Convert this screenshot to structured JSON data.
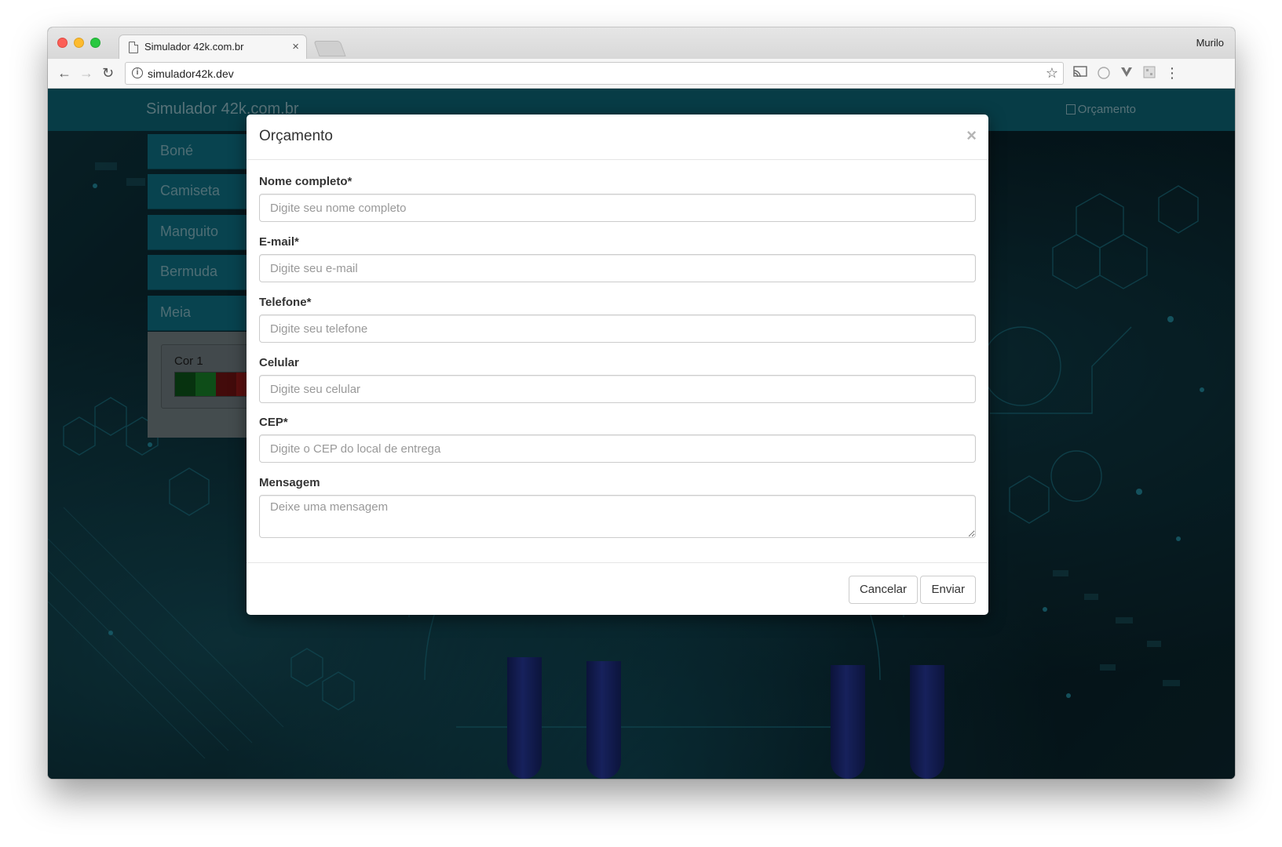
{
  "browser": {
    "tab_title": "Simulador 42k.com.br",
    "tab_close": "×",
    "profile_name": "Murilo",
    "url": "simulador42k.dev",
    "back_icon": "←",
    "forward_icon": "→",
    "reload_icon": "↻",
    "star_icon": "☆",
    "menu_icon": "⋮"
  },
  "site": {
    "brand": "Simulador 42k.com.br",
    "nav_link": "Orçamento",
    "menu": [
      "Boné",
      "Camiseta",
      "Manguito",
      "Bermuda",
      "Meia"
    ],
    "panel_label": "Cor 1",
    "swatch_colors": [
      "#0e5c1d",
      "#1a8c2c",
      "#7a1414",
      "#a81c1c"
    ]
  },
  "modal": {
    "title": "Orçamento",
    "close": "×",
    "fields": {
      "name_label": "Nome completo*",
      "name_placeholder": "Digite seu nome completo",
      "email_label": "E-mail*",
      "email_placeholder": "Digite seu e-mail",
      "phone_label": "Telefone*",
      "phone_placeholder": "Digite seu telefone",
      "mobile_label": "Celular",
      "mobile_placeholder": "Digite seu celular",
      "cep_label": "CEP*",
      "cep_placeholder": "Digite o CEP do local de entrega",
      "message_label": "Mensagem",
      "message_placeholder": "Deixe uma mensagem"
    },
    "cancel_label": "Cancelar",
    "submit_label": "Enviar"
  }
}
